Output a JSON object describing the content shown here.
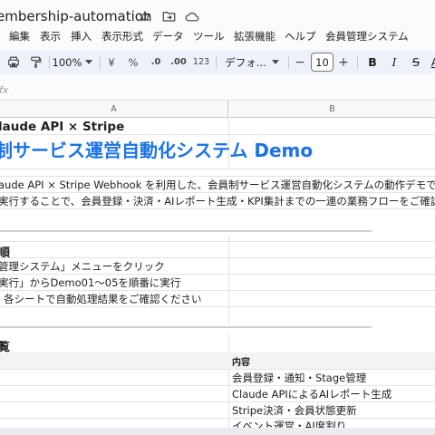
{
  "app": {
    "doc_title": "embership-automation"
  },
  "menu": {
    "items": [
      "編集",
      "表示",
      "挿入",
      "表示形式",
      "データ",
      "ツール",
      "拡張機能",
      "ヘルプ",
      "会員管理システム"
    ]
  },
  "toolbar": {
    "zoom": "100%",
    "currency": "¥",
    "percent": "%",
    "dec_decrease": ".0",
    "dec_increase": ".00",
    "number_format": "123",
    "font_name": "デフォ...",
    "font_size": "10",
    "minus": "−",
    "plus": "+",
    "bold": "B",
    "italic": "I",
    "strike": "S",
    "underline": "A"
  },
  "formula": {
    "fx": "fx"
  },
  "columns": {
    "a": "A",
    "b": "B"
  },
  "sheet": {
    "subtitle": "laude API × Stripe",
    "title": "制サービス運営自動化システム Demo",
    "desc_line1": "aude API × Stripe Webhook を利用した、会員制サービス運営自動化システムの動作デモです。",
    "desc_line2": "実行することで、会員登録・決済・AIレポート生成・KPI集計までの一連の業務フローをご確認",
    "steps_heading": "順",
    "step1": "管理システム」メニューをクリック",
    "step2": "実行」からDemo01〜05を順番に実行",
    "step3": "各シートで自動処理結果をご確認ください",
    "overview_heading": "覧",
    "table_header": "内容",
    "rows": [
      "会員登録・通知・Stage管理",
      "Claude APIによるAIレポート生成",
      "Stripe決済・会員状態更新",
      "イベント運営・AI席割り"
    ]
  }
}
